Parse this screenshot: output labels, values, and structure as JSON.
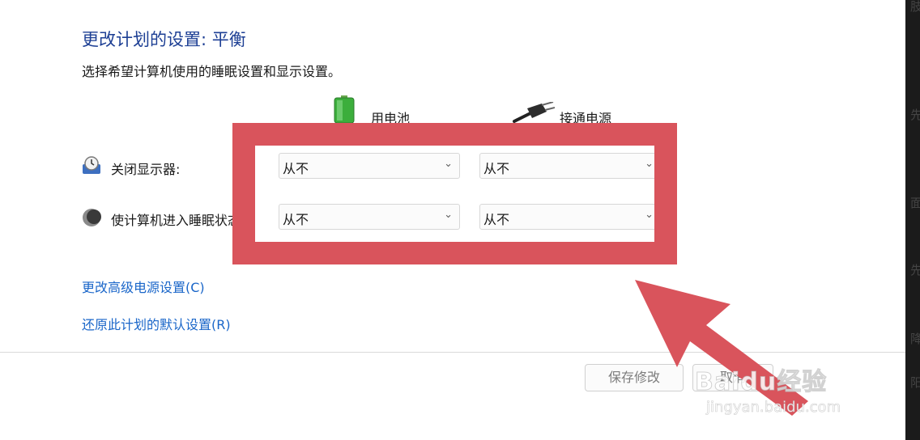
{
  "header": {
    "title": "更改计划的设置: 平衡",
    "subtitle": "选择希望计算机使用的睡眠设置和显示设置。"
  },
  "columns": {
    "battery_label": "用电池",
    "plugged_label": "接通电源"
  },
  "rows": [
    {
      "label": "关闭显示器:",
      "battery_value": "从不",
      "plugged_value": "从不"
    },
    {
      "label": "使计算机进入睡眠状态:",
      "battery_value": "从不",
      "plugged_value": "从不"
    }
  ],
  "links": {
    "advanced": "更改高级电源设置(C)",
    "restore": "还原此计划的默认设置(R)"
  },
  "buttons": {
    "save": "保存修改",
    "cancel": "取消"
  },
  "edge_chars": [
    "肢",
    "先",
    "面",
    "先",
    "降",
    "阳"
  ],
  "watermark": {
    "main": "Baidu经验",
    "sub": "jingyan.baidu.com"
  },
  "colors": {
    "title": "#1d3f94",
    "link": "#1a66c9",
    "highlight": "#d9545c"
  },
  "icons": {
    "battery": "battery-icon",
    "plug": "power-plug-icon",
    "display": "monitor-clock-icon",
    "sleep": "moon-icon",
    "dropdown": "chevron-down-icon"
  }
}
